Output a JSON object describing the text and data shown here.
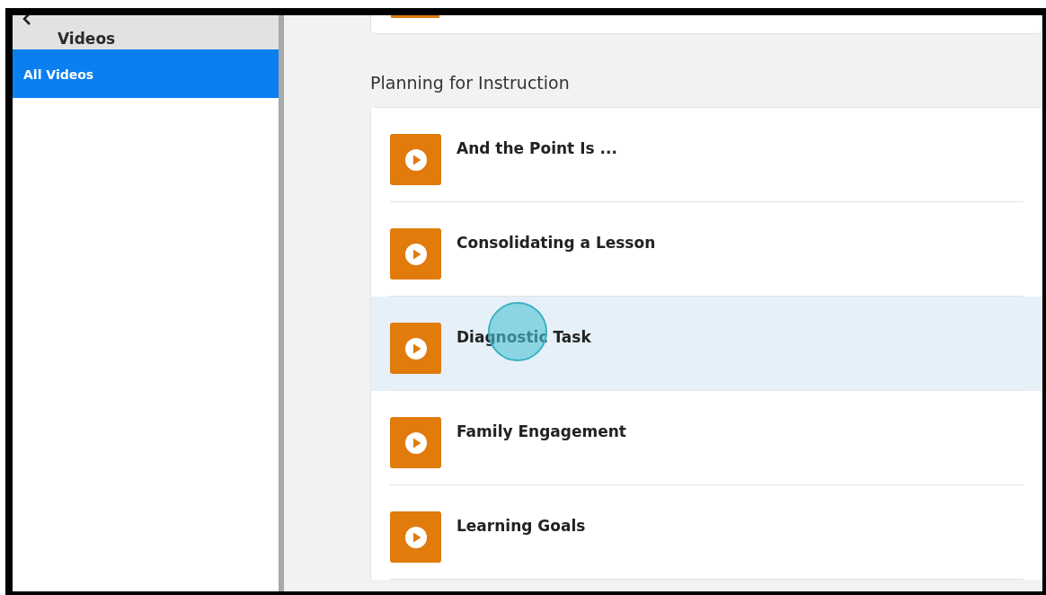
{
  "sidebar": {
    "header": "Videos",
    "items": [
      {
        "label": "All Videos",
        "selected": true
      }
    ]
  },
  "section": {
    "heading": "Planning for Instruction",
    "videos": [
      {
        "title": "And the Point Is ...",
        "selected": false,
        "clicked": false
      },
      {
        "title": "Consolidating a Lesson",
        "selected": false,
        "clicked": false
      },
      {
        "title": "Diagnostic Task",
        "selected": true,
        "clicked": true
      },
      {
        "title": "Family Engagement",
        "selected": false,
        "clicked": false
      },
      {
        "title": "Learning Goals",
        "selected": false,
        "clicked": false
      }
    ]
  }
}
